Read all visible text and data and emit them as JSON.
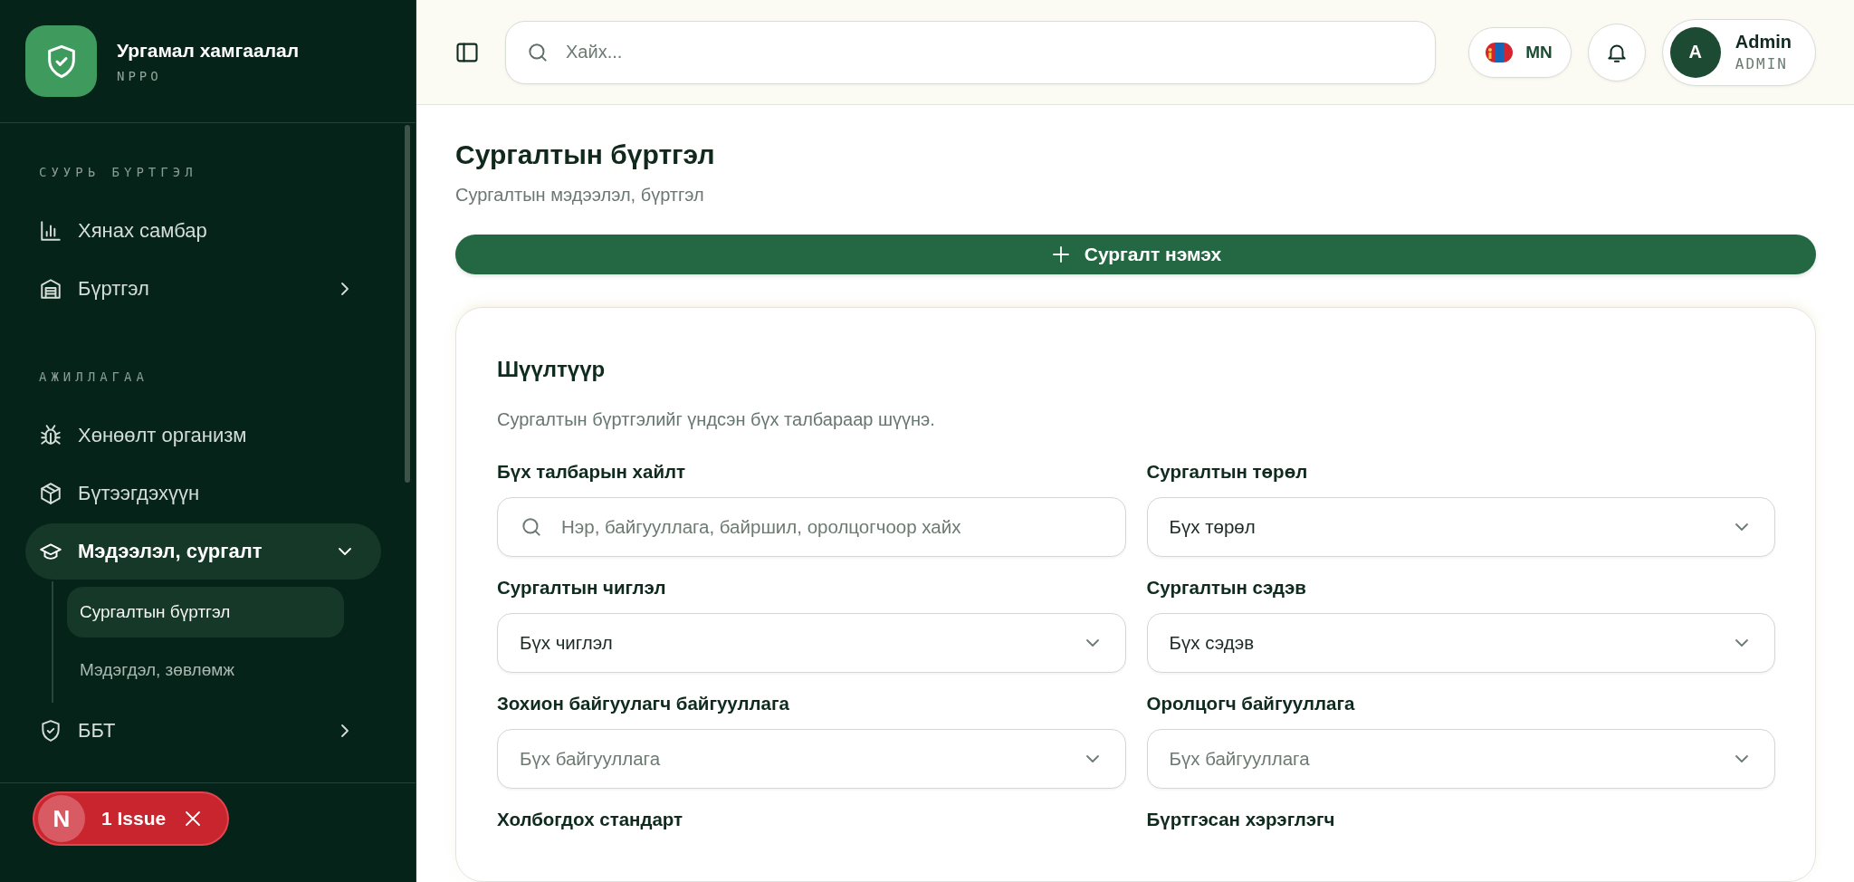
{
  "sidebar": {
    "brand": {
      "title": "Ургамал хамгаалал",
      "subtitle": "NPPO"
    },
    "sections": [
      {
        "label": "СУУРЬ БҮРТГЭЛ",
        "items": [
          {
            "label": "Хянах самбар",
            "kind": "link",
            "selected": false
          },
          {
            "label": "Бүртгэл",
            "kind": "group",
            "selected": false,
            "expanded": false
          }
        ]
      },
      {
        "label": "АЖИЛЛАГАА",
        "items": [
          {
            "label": "Хөнөөлт организм",
            "kind": "link",
            "selected": false
          },
          {
            "label": "Бүтээгдэхүүн",
            "kind": "link",
            "selected": false
          },
          {
            "label": "Мэдээлэл, сургалт",
            "kind": "group",
            "selected": true,
            "expanded": true,
            "children": [
              {
                "label": "Сургалтын бүртгэл",
                "selected": true
              },
              {
                "label": "Мэдэгдэл, зөвлөмж",
                "selected": false
              }
            ]
          },
          {
            "label": "ББТ",
            "kind": "group",
            "selected": false,
            "expanded": false
          }
        ]
      }
    ],
    "issue_badge": {
      "logo": "N",
      "label": "1 Issue"
    }
  },
  "header": {
    "search": {
      "placeholder": "Хайх..."
    },
    "language": "MN",
    "user": {
      "initial": "A",
      "name": "Admin",
      "role": "ADMIN"
    }
  },
  "page": {
    "title": "Сургалтын бүртгэл",
    "subtitle": "Сургалтын мэдээлэл, бүртгэл",
    "add_button": "Сургалт нэмэх",
    "filter": {
      "title": "Шүүлтүүр",
      "description": "Сургалтын бүртгэлийг үндсэн бүх талбараар шүүнэ.",
      "fields": [
        {
          "label": "Бүх талбарын хайлт",
          "kind": "search",
          "placeholder": "Нэр, байгууллага, байршил, оролцогчоор хайх"
        },
        {
          "label": "Сургалтын төрөл",
          "kind": "select",
          "value": "Бүх төрөл"
        },
        {
          "label": "Сургалтын чиглэл",
          "kind": "select",
          "value": "Бүх чиглэл"
        },
        {
          "label": "Сургалтын сэдэв",
          "kind": "select",
          "value": "Бүх сэдэв"
        },
        {
          "label": "Зохион байгуулагч байгууллага",
          "kind": "select",
          "placeholder": "Бүх байгууллага"
        },
        {
          "label": "Оролцогч байгууллага",
          "kind": "select",
          "placeholder": "Бүх байгууллага"
        },
        {
          "label": "Холбогдох стандарт",
          "kind": "label"
        },
        {
          "label": "Бүртгэсан хэрэглэгч",
          "kind": "label"
        }
      ]
    }
  }
}
